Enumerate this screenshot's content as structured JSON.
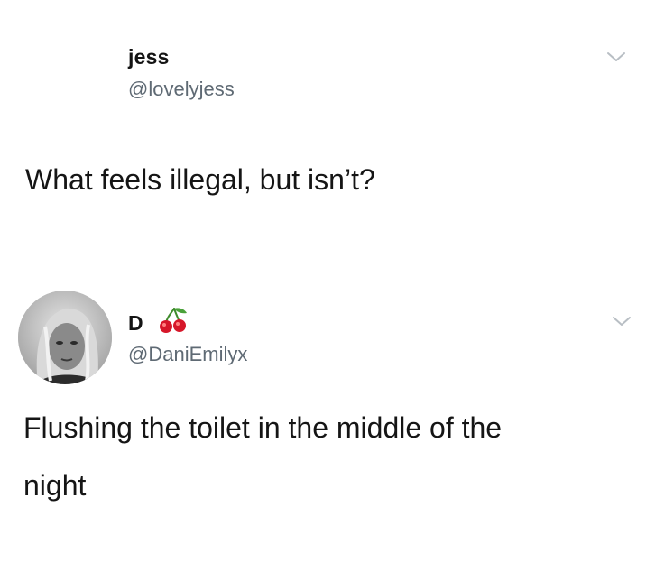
{
  "tweets": [
    {
      "display_name": "jess",
      "handle": "@lovelyjess",
      "text": "What feels illegal, but isn’t?",
      "menu_icon": "chevron-down-icon"
    },
    {
      "display_name": "D",
      "name_emoji": "cherry-icon",
      "handle": "@DaniEmilyx",
      "text_line_1": "Flushing the toilet in the middle of the",
      "text_line_2": "night",
      "avatar_icon": "avatar",
      "menu_icon": "chevron-down-icon"
    }
  ],
  "colors": {
    "text": "#141414",
    "handle": "#5f6a74",
    "chevron": "#b8bec4",
    "cherry_red": "#d6172a",
    "cherry_stem": "#3f8b2c"
  }
}
